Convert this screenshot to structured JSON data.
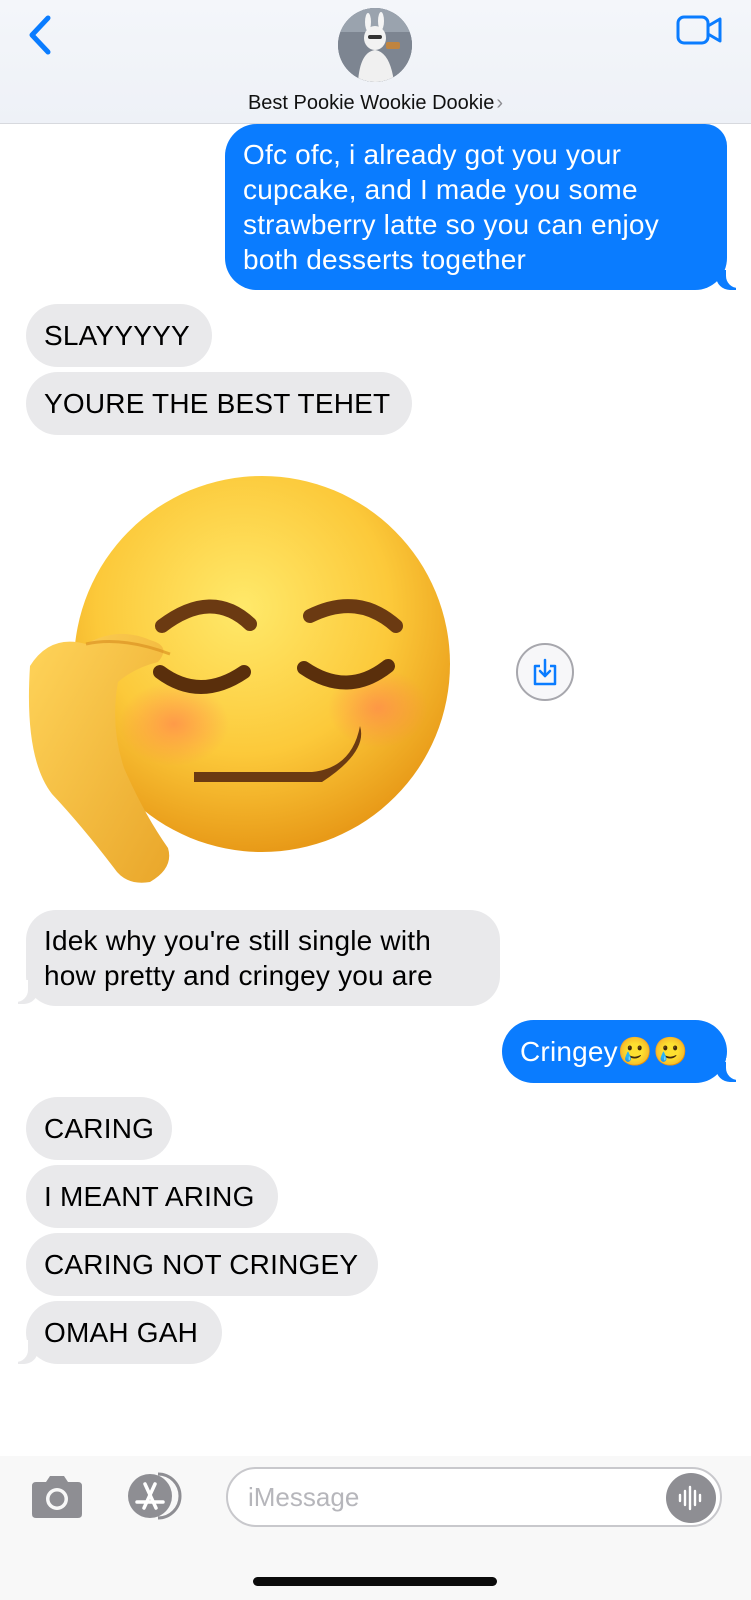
{
  "header": {
    "contact_name": "Best Pookie Wookie Dookie",
    "chevron": "›",
    "back_icon": "chevron-left-icon",
    "video_icon": "video-camera-icon"
  },
  "messages": [
    {
      "direction": "out",
      "text_lines": [
        "Ofc ofc, i already got you your",
        "cupcake, and I made you some",
        "strawberry latte so you can enjoy",
        "both desserts together"
      ]
    },
    {
      "direction": "in",
      "text": "SLAYYYYY"
    },
    {
      "direction": "in",
      "text": "YOURE THE BEST TEHET"
    },
    {
      "direction": "in",
      "type": "image",
      "icon": "smirking-face-emoji-image"
    },
    {
      "direction": "in",
      "text_lines": [
        "Idek why you're still single with",
        "how pretty and cringey you are"
      ]
    },
    {
      "direction": "out",
      "text": "Cringey🥲🥲"
    },
    {
      "direction": "in",
      "text": "CARING"
    },
    {
      "direction": "in",
      "text": "I MEANT ARING"
    },
    {
      "direction": "in",
      "text": "CARING NOT CRINGEY"
    },
    {
      "direction": "in",
      "text": "OMAH GAH"
    }
  ],
  "input_bar": {
    "placeholder": "iMessage",
    "camera_icon": "camera-icon",
    "apps_icon": "app-store-icon",
    "audio_icon": "audio-waveform-icon"
  },
  "colors": {
    "outgoing_bubble": "#0a7cff",
    "incoming_bubble": "#e9e9eb",
    "accent": "#0a7cff"
  }
}
